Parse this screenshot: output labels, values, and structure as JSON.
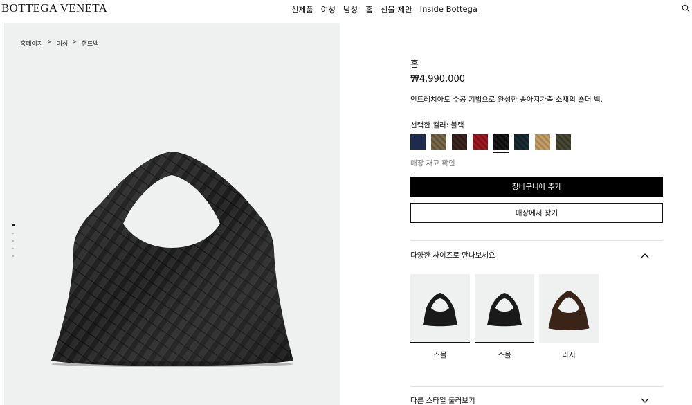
{
  "brand": {
    "logo": "BOTTEGA VENETA"
  },
  "nav": {
    "items": [
      "신제품",
      "여성",
      "남성",
      "홈",
      "선물 제안",
      "Inside Bottega"
    ]
  },
  "breadcrumb": {
    "items": [
      "홈페이지",
      "여성",
      "핸드백"
    ],
    "separator": ">"
  },
  "gallery": {
    "slide_count": 5,
    "active_slide": 1
  },
  "product": {
    "name": "홉",
    "price": "₩4,990,000",
    "description": "인트레치아토 수공 기법으로 완성한 송아지가죽 소재의 숄더 백.",
    "color_label": "선택한 컬러:",
    "color_value": "블랙",
    "swatches": [
      {
        "name": "navy",
        "color": "#1f2b4d"
      },
      {
        "name": "olive-brown",
        "color": "#7a6a4c"
      },
      {
        "name": "dark-brown",
        "color": "#3e2620"
      },
      {
        "name": "red",
        "color": "#a11a22"
      },
      {
        "name": "black",
        "color": "#141414",
        "selected": true
      },
      {
        "name": "deep-teal",
        "color": "#1a2e36"
      },
      {
        "name": "tan",
        "color": "#c29e6a"
      },
      {
        "name": "dark-olive",
        "color": "#4a4a34"
      }
    ],
    "stock_link": "매장 재고 확인",
    "add_to_cart": "장바구니에 추가",
    "find_in_store": "매장에서 찾기"
  },
  "sizes": {
    "heading": "다양한 사이즈로 만나보세요",
    "items": [
      {
        "label": "스몰",
        "color": "#1a1a1a",
        "selected": true
      },
      {
        "label": "스몰",
        "color": "#1a1a1a",
        "selected": true
      },
      {
        "label": "라지",
        "color": "#3a2418",
        "selected": false
      }
    ]
  },
  "other_styles": {
    "heading": "다른 스타일 둘러보기"
  }
}
